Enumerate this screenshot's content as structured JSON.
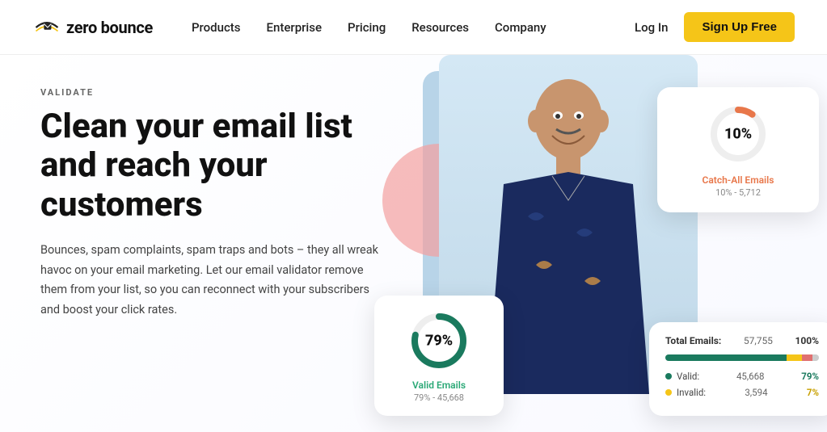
{
  "nav": {
    "logo_text": "zero bounce",
    "links": [
      "Products",
      "Enterprise",
      "Pricing",
      "Resources",
      "Company"
    ],
    "login_label": "Log In",
    "signup_label": "Sign Up Free"
  },
  "hero": {
    "validate_label": "VALIDATE",
    "title": "Clean your email list and reach your customers",
    "description": "Bounces, spam complaints, spam traps and bots – they all wreak havoc on your email marketing. Let our email validator remove them from your list, so you can reconnect with your subscribers and boost your click rates."
  },
  "card_catchall": {
    "percent": "10%",
    "label": "Catch-All Emails",
    "sub": "10% - 5,712"
  },
  "card_valid": {
    "percent": "79%",
    "label": "Valid Emails",
    "sub": "79% - 45,668"
  },
  "card_breakdown": {
    "title": "Total Emails:",
    "total": "57,755",
    "total_pct": "100%",
    "rows": [
      {
        "label": "Valid:",
        "count": "45,668",
        "pct": "79%",
        "color": "#1a7a5e"
      },
      {
        "label": "Invalid:",
        "count": "3,594",
        "pct": "7%",
        "color": "#c8a000"
      }
    ]
  }
}
